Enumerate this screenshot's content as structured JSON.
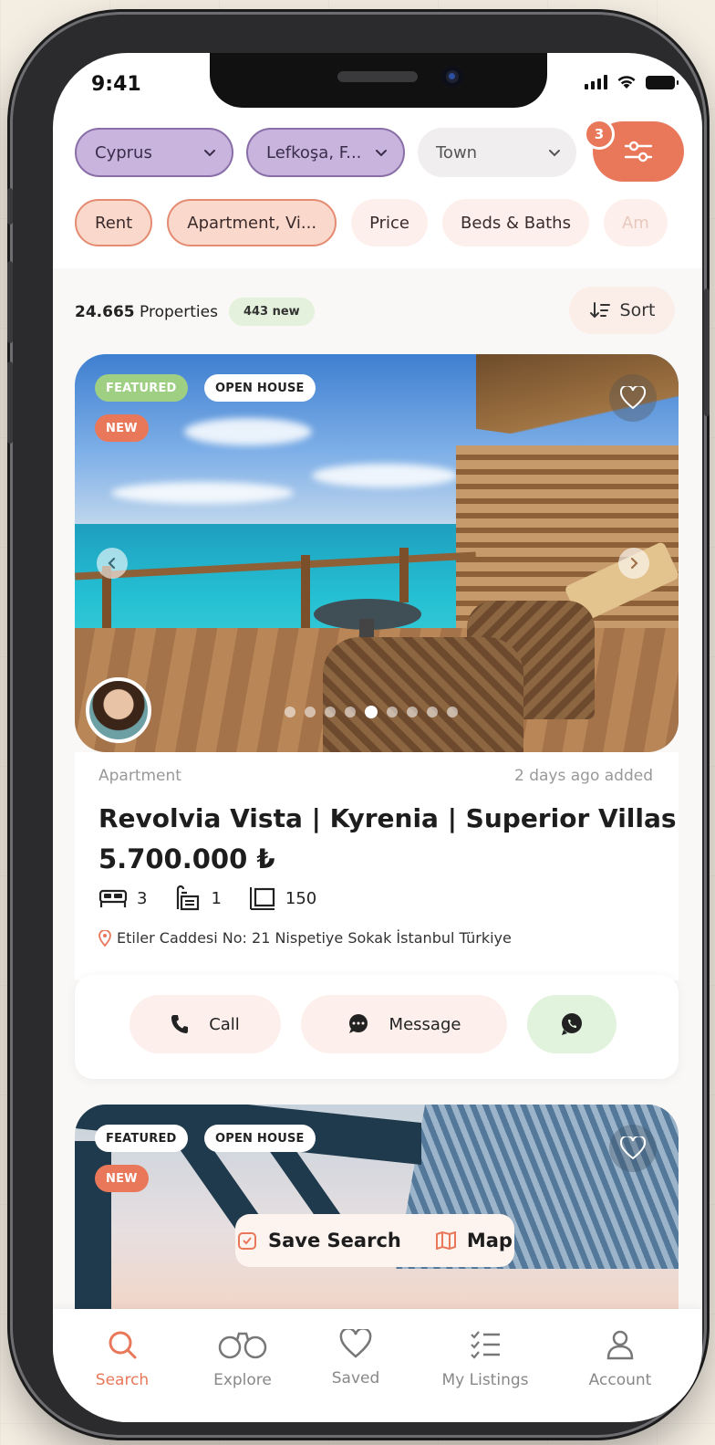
{
  "status_bar": {
    "time": "9:41"
  },
  "filters": {
    "country": "Cyprus",
    "city": "Lefkoşa, F...",
    "town_placeholder": "Town",
    "filter_count": "3"
  },
  "chips": [
    {
      "label": "Rent"
    },
    {
      "label": "Apartment, Vi..."
    },
    {
      "label": "Price"
    },
    {
      "label": "Beds & Baths"
    },
    {
      "label": "Am"
    }
  ],
  "results": {
    "count": "24.665",
    "count_suffix": "Properties",
    "new_badge": "443 new",
    "sort_label": "Sort"
  },
  "listing1": {
    "tags": {
      "featured": "FEATURED",
      "open_house": "OPEN HOUSE",
      "new": "NEW"
    },
    "type": "Apartment",
    "added": "2 days ago added",
    "title": "Revolvia Vista | Kyrenia | Superior Villas",
    "price": "5.700.000 ₺",
    "beds": "3",
    "baths": "1",
    "area": "150",
    "address": "Etiler Caddesi No: 21 Nispetiye Sokak İstanbul Türkiye",
    "image_total": 9,
    "image_active": 5,
    "actions": {
      "call": "Call",
      "message": "Message"
    }
  },
  "listing2": {
    "tags": {
      "featured": "FEATURED",
      "open_house": "OPEN HOUSE",
      "new": "NEW"
    }
  },
  "floating": {
    "save_search": "Save Search",
    "map": "Map"
  },
  "bottom_nav": {
    "search": "Search",
    "explore": "Explore",
    "saved": "Saved",
    "my_listings": "My Listings",
    "account": "Account"
  },
  "colors": {
    "accent": "#e9785b",
    "purple_select": "#c9b4de",
    "featured_green": "#9fcf83"
  },
  "icons": [
    "chevron-down-icon",
    "sliders-icon",
    "sort-icon",
    "heart-icon",
    "chevron-left-icon",
    "chevron-right-icon",
    "bed-icon",
    "bath-icon",
    "area-icon",
    "location-pin-icon",
    "phone-icon",
    "message-icon",
    "whatsapp-icon",
    "save-search-icon",
    "map-icon",
    "search-icon",
    "binoculars-icon",
    "account-icon",
    "list-icon"
  ]
}
